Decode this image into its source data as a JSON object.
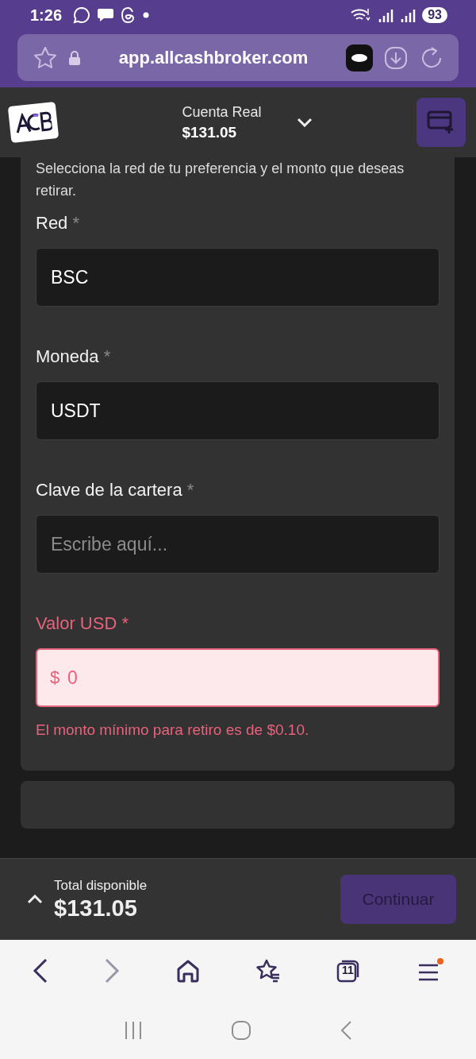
{
  "status_bar": {
    "time": "1:26",
    "battery": "93"
  },
  "browser": {
    "url": "app.allcashbroker.com",
    "tab_count": "11"
  },
  "header": {
    "account_label": "Cuenta Real",
    "balance": "$131.05"
  },
  "form": {
    "intro": "Selecciona la red de tu preferencia y el monto que deseas retirar.",
    "fields": [
      {
        "label": "Red",
        "required_mark": "*",
        "value": "BSC",
        "invalid": false
      },
      {
        "label": "Moneda",
        "required_mark": "*",
        "value": "USDT",
        "invalid": false
      },
      {
        "label": "Clave de la cartera",
        "required_mark": "*",
        "placeholder": "Escribe aquí...",
        "invalid": false
      },
      {
        "label": "Valor USD",
        "required_mark": "*",
        "prefix": "$",
        "value": "0",
        "invalid": true,
        "error": "El monto mínimo para retiro es de $0.10."
      }
    ]
  },
  "footer": {
    "label": "Total disponible",
    "amount": "$131.05",
    "button": "Continuar"
  }
}
